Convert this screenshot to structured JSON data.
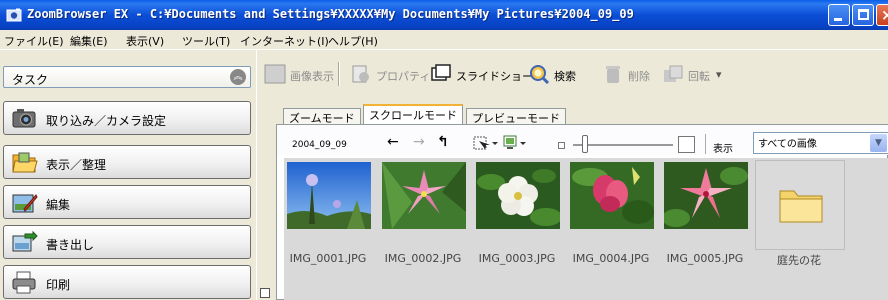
{
  "window": {
    "title": "ZoomBrowser EX  -  C:¥Documents and Settings¥XXXXX¥My Documents¥My Pictures¥2004_09_09"
  },
  "menu": [
    "ファイル(E)",
    "編集(E)",
    "表示(V)",
    "ツール(T)",
    "インターネット(I)",
    "ヘルプ(H)"
  ],
  "task": {
    "header": "タスク",
    "items": [
      "取り込み／カメラ設定",
      "表示／整理",
      "編集",
      "書き出し",
      "印刷"
    ]
  },
  "toolbar": {
    "view": "画像表示",
    "properties": "プロパティ",
    "slideshow": "スライドショー",
    "search": "検索",
    "delete": "削除",
    "rotate": "回転"
  },
  "tabs": [
    "ズームモード",
    "スクロールモード",
    "プレビューモード"
  ],
  "active_tab": "スクロールモード",
  "browser": {
    "folder": "2004_09_09",
    "display_label": "表示",
    "filter_value": "すべての画像"
  },
  "thumbnails": [
    {
      "name": "IMG_0001.JPG"
    },
    {
      "name": "IMG_0002.JPG"
    },
    {
      "name": "IMG_0003.JPG"
    },
    {
      "name": "IMG_0004.JPG"
    },
    {
      "name": "IMG_0005.JPG"
    }
  ],
  "folder_item": "庭先の花",
  "colors": {
    "titlebar": "#0b4fd6",
    "menubar": "#ece9d8",
    "grid_bg": "#d9d9d9",
    "tab_highlight": "#f0b336"
  }
}
